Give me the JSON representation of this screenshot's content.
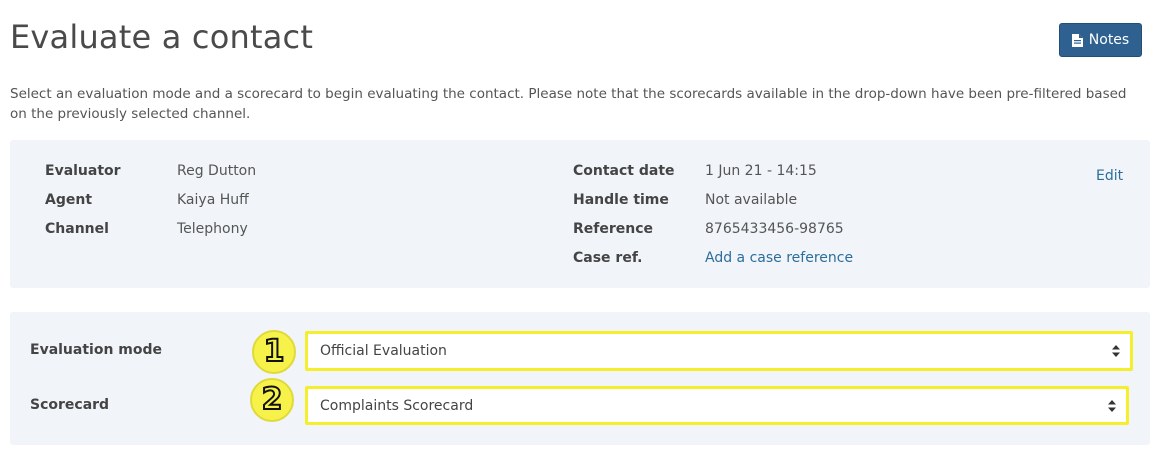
{
  "header": {
    "title": "Evaluate a contact",
    "notes_label": "Notes"
  },
  "intro_text": "Select an evaluation mode and a scorecard to begin evaluating the contact. Please note that the scorecards available in the drop-down have been pre-filtered based on the previously selected channel.",
  "details": {
    "evaluator_label": "Evaluator",
    "evaluator_value": "Reg Dutton",
    "agent_label": "Agent",
    "agent_value": "Kaiya Huff",
    "channel_label": "Channel",
    "channel_value": "Telephony",
    "contact_date_label": "Contact date",
    "contact_date_value": "1 Jun 21 - 14:15",
    "handle_time_label": "Handle time",
    "handle_time_value": "Not available",
    "reference_label": "Reference",
    "reference_value": "8765433456-98765",
    "case_ref_label": "Case ref.",
    "case_ref_link": "Add a case reference",
    "edit_label": "Edit"
  },
  "form": {
    "mode_label": "Evaluation mode",
    "mode_value": "Official Evaluation",
    "scorecard_label": "Scorecard",
    "scorecard_value": "Complaints Scorecard"
  },
  "annotations": {
    "step1": "1",
    "step2": "2",
    "highlight_color": "#f5ee2a"
  },
  "colors": {
    "accent": "#2e6190",
    "link": "#2c6d9c",
    "panel_bg": "#f1f5f9"
  }
}
